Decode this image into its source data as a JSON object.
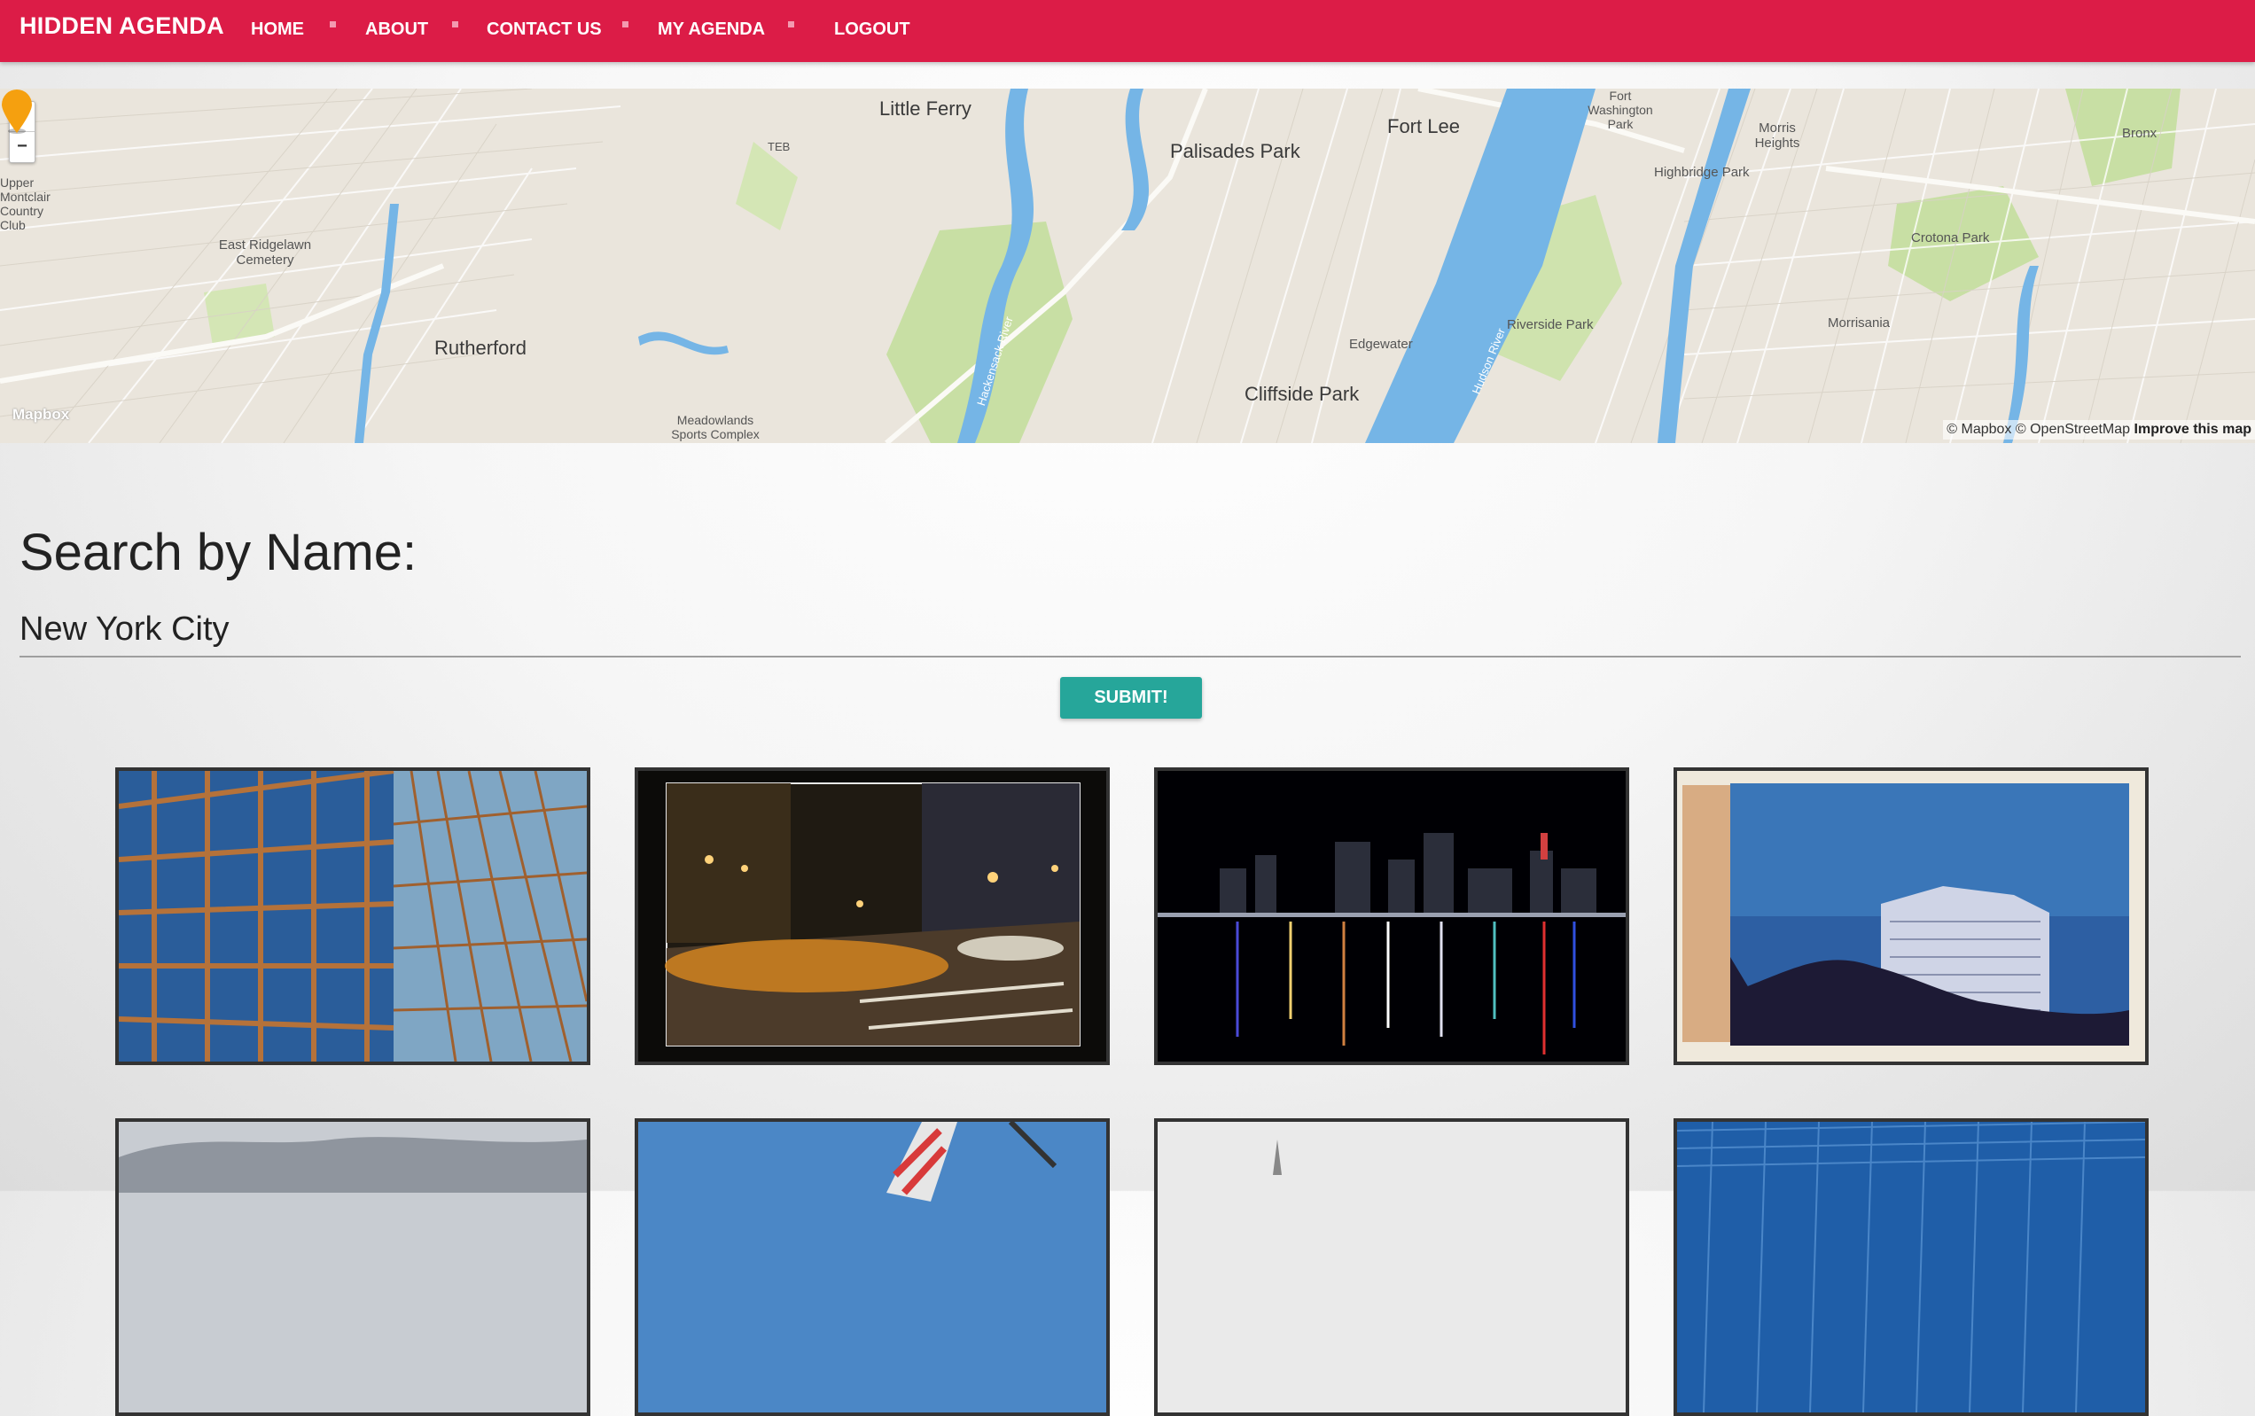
{
  "nav": {
    "brand": "HIDDEN AGENDA",
    "items": [
      "HOME",
      "ABOUT",
      "CONTACT US",
      "MY AGENDA",
      "LOGOUT"
    ]
  },
  "map": {
    "zoom_in": "+",
    "zoom_out": "−",
    "places_large": [
      "Little Ferry",
      "Palisades Park",
      "Fort Lee",
      "Rutherford",
      "Cliffside Park"
    ],
    "places_small": [
      "Edgewater",
      "Morrisania",
      "Crotona Park",
      "Highbridge Park",
      "Riverside Park",
      "East Ridgelawn Cemetery",
      "Upper Montclair Country Club",
      "Meadowlands Sports Complex",
      "Fort Washington Park",
      "Morris Heights",
      "Bronx",
      "TEB",
      "Hudson River",
      "Hackensack River"
    ],
    "logo": "Mapbox",
    "attribution": "© Mapbox © OpenStreetMap",
    "improve_link": "Improve this map",
    "marker_color": "#f5a00f"
  },
  "search": {
    "title": "Search by Name:",
    "value": "New York City",
    "submit_label": "SUBMIT!"
  },
  "photos": [
    {
      "subject": "glass office tower facade"
    },
    {
      "subject": "city street at night with taxis"
    },
    {
      "subject": "night skyline over river"
    },
    {
      "subject": "MetLife building polaroid"
    },
    {
      "subject": "cloudy sky"
    },
    {
      "subject": "ship flag against sky"
    },
    {
      "subject": "white sky with skyline spire"
    },
    {
      "subject": "blue glass grid"
    }
  ],
  "colors": {
    "nav": "#dc1c47",
    "button": "#26a69a",
    "water": "#75b5e6",
    "park": "#c8dfa4"
  }
}
